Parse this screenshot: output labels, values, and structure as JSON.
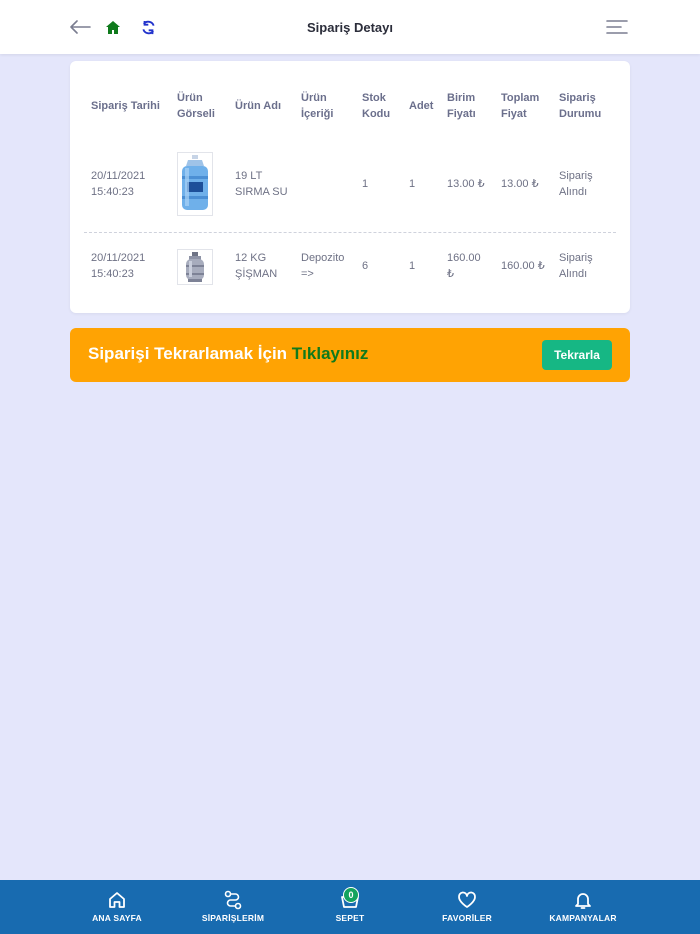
{
  "header": {
    "title": "Sipariş Detayı",
    "icons": [
      "back-arrow-icon",
      "home-icon",
      "refresh-icon",
      "menu-icon"
    ],
    "colors": {
      "home": "#0f7a1c",
      "refresh": "#2233cc"
    }
  },
  "table": {
    "columns": [
      [
        "Sipariş Tarihi"
      ],
      [
        "Ürün",
        "Görseli"
      ],
      [
        "Ürün Adı"
      ],
      [
        "Ürün",
        "İçeriği"
      ],
      [
        "Stok",
        "Kodu"
      ],
      [
        "Adet"
      ],
      [
        "Birim",
        "Fiyatı"
      ],
      [
        "Toplam",
        "Fiyat"
      ],
      [
        "Sipariş",
        "Durumu"
      ]
    ],
    "rows": [
      {
        "date": [
          "20/11/2021",
          "15:40:23"
        ],
        "image": "water-bottle-image",
        "name": [
          "19 LT",
          "SIRMA SU"
        ],
        "content": [
          "",
          ""
        ],
        "stock_code": "1",
        "quantity": "1",
        "unit_price": [
          "13.00 ₺",
          ""
        ],
        "total_price": "13.00 ₺",
        "status": [
          "Sipariş",
          "Alındı"
        ]
      },
      {
        "date": [
          "20/11/2021",
          "15:40:23"
        ],
        "image": "gas-cylinder-image",
        "name": [
          "12 KG",
          "ŞİŞMAN"
        ],
        "content": [
          "Depozito",
          "=>"
        ],
        "stock_code": "6",
        "quantity": "1",
        "unit_price": [
          "160.00",
          "₺"
        ],
        "total_price": "160.00 ₺",
        "status": [
          "Sipariş",
          "Alındı"
        ]
      }
    ]
  },
  "banner": {
    "text_main": "Siparişi Tekrarlamak İçin ",
    "text_highlight": "Tıklayınız",
    "button_label": "Tekrarla",
    "colors": {
      "background": "#ffa303",
      "highlight": "#0f7a1c",
      "button": "#16b784"
    }
  },
  "bottom_nav": {
    "background": "#186bb0",
    "items": [
      {
        "label": "ANA SAYFA",
        "icon": "home-outline-icon"
      },
      {
        "label": "SİPARİŞLERİM",
        "icon": "route-icon"
      },
      {
        "label": "SEPET",
        "icon": "basket-icon"
      },
      {
        "label": "FAVORİLER",
        "icon": "heart-icon"
      },
      {
        "label": "KAMPANYALAR",
        "icon": "bell-icon"
      }
    ],
    "cart_count": "0"
  }
}
